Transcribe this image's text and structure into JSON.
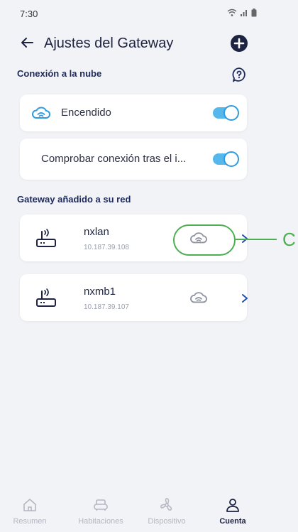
{
  "status_bar": {
    "time": "7:30"
  },
  "header": {
    "title": "Ajustes del Gateway"
  },
  "cloud_section": {
    "title": "Conexión a la nube",
    "items": [
      {
        "label": "Encendido",
        "enabled": true
      },
      {
        "label": "Comprobar conexión tras el i...",
        "enabled": true
      }
    ]
  },
  "gateway_section": {
    "title": "Gateway añadido a su red",
    "gateways": [
      {
        "name": "nxlan",
        "ip": "10.187.39.108"
      },
      {
        "name": "nxmb1",
        "ip": "10.187.39.107"
      }
    ]
  },
  "annotation": {
    "label": "C",
    "color": "#4caf50"
  },
  "bottom_nav": {
    "items": [
      {
        "label": "Resumen",
        "icon": "home-icon"
      },
      {
        "label": "Habitaciones",
        "icon": "sofa-icon"
      },
      {
        "label": "Dispositivo",
        "icon": "fan-icon"
      },
      {
        "label": "Cuenta",
        "icon": "user-icon",
        "active": true
      }
    ]
  },
  "colors": {
    "accent": "#2f9be0",
    "title": "#1d2340",
    "background": "#f2f3f7"
  }
}
